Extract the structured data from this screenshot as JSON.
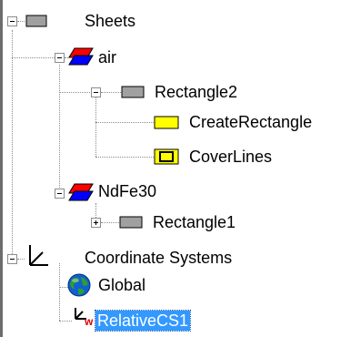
{
  "tree": {
    "items": [
      {
        "label": "Sheets",
        "icon": "gray-rectangle-icon"
      },
      {
        "label": "air",
        "icon": "material-layers-icon"
      },
      {
        "label": "Rectangle2",
        "icon": "gray-rectangle-icon"
      },
      {
        "label": "CreateRectangle",
        "icon": "yellow-rectangle-icon"
      },
      {
        "label": "CoverLines",
        "icon": "cover-lines-icon"
      },
      {
        "label": "NdFe30",
        "icon": "material-layers-icon"
      },
      {
        "label": "Rectangle1",
        "icon": "gray-rectangle-icon"
      },
      {
        "label": "Coordinate Systems",
        "icon": "axes-icon"
      },
      {
        "label": "Global",
        "icon": "globe-icon"
      },
      {
        "label": "RelativeCS1",
        "icon": "relative-cs-icon",
        "selected": true
      }
    ]
  },
  "colors": {
    "selection": "#3399ff",
    "yellow": "#ffff00",
    "gray_rect": "#a0a0a0",
    "material_red": "#ff0000",
    "material_blue": "#0000ff"
  }
}
